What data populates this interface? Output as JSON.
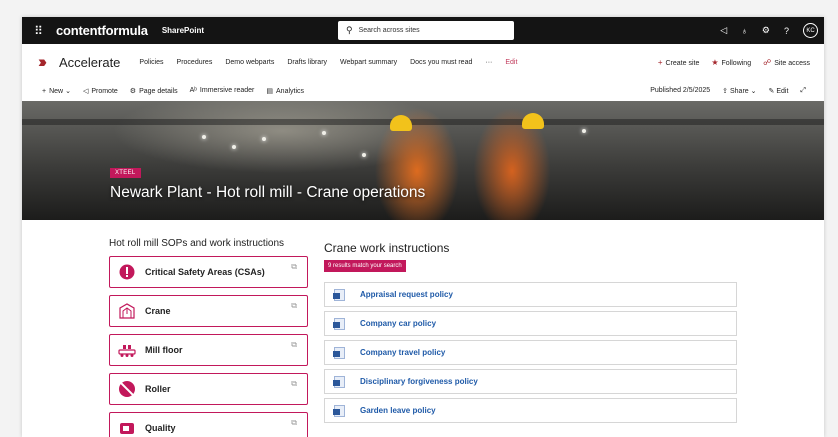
{
  "suitebar": {
    "waffle": "⠿",
    "brand": "contentformula",
    "app": "SharePoint",
    "search_placeholder": "Search across sites",
    "avatar": "KC"
  },
  "site": {
    "name": "Accelerate",
    "nav": [
      "Policies",
      "Procedures",
      "Demo webparts",
      "Drafts library",
      "Webpart summary",
      "Docs you must read",
      "···",
      "Edit"
    ],
    "actions": {
      "create": "Create site",
      "following": "Following",
      "access": "Site access"
    }
  },
  "commandbar": {
    "new": "New",
    "promote": "Promote",
    "page_details": "Page details",
    "immersive": "Immersive reader",
    "analytics": "Analytics",
    "published": "Published 2/5/2025",
    "share": "Share",
    "edit": "Edit"
  },
  "hero": {
    "tag": "XTEEL",
    "title": "Newark Plant - Hot roll mill - Crane operations"
  },
  "left": {
    "title": "Hot roll mill SOPs and work instructions",
    "cards": [
      {
        "label": "Critical Safety Areas (CSAs)",
        "icon": "alert-icon"
      },
      {
        "label": "Crane",
        "icon": "crane-icon"
      },
      {
        "label": "Mill floor",
        "icon": "mill-floor-icon"
      },
      {
        "label": "Roller",
        "icon": "roller-icon"
      },
      {
        "label": "Quality",
        "icon": "quality-icon"
      }
    ]
  },
  "right": {
    "title": "Crane work instructions",
    "badge": "9 results match your search",
    "results": [
      "Appraisal request policy",
      "Company car policy",
      "Company travel policy",
      "Disciplinary forgiveness policy",
      "Garden leave policy"
    ]
  },
  "colors": {
    "accent": "#c2185b",
    "link": "#1f5aa8",
    "suitebar": "#141414",
    "logo": "#a4262c"
  }
}
